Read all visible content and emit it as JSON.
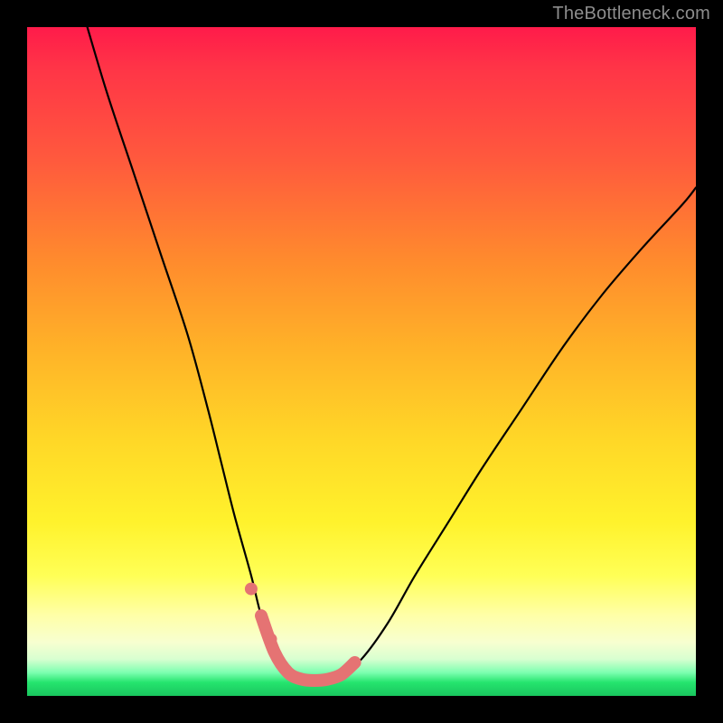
{
  "watermark": "TheBottleneck.com",
  "colors": {
    "background_frame": "#000000",
    "gradient_top": "#ff1b4a",
    "gradient_mid1": "#ff8b2d",
    "gradient_mid2": "#ffd827",
    "gradient_low": "#ffffa8",
    "gradient_bottom": "#19c65e",
    "curve": "#000000",
    "marker": "#e57373"
  },
  "chart_data": {
    "type": "line",
    "title": "",
    "xlabel": "",
    "ylabel": "",
    "xlim": [
      0,
      100
    ],
    "ylim": [
      0,
      100
    ],
    "note": "Axis values are in relative plot-percent coordinates (no tick labels are visible in the image).",
    "series": [
      {
        "name": "bottleneck-curve",
        "x": [
          9,
          12,
          16,
          20,
          24,
          27,
          29,
          31,
          33.5,
          35,
          37,
          39,
          41,
          43,
          45,
          47,
          50,
          54,
          58,
          63,
          68,
          74,
          80,
          86,
          92,
          98,
          100
        ],
        "y": [
          100,
          90,
          78,
          66,
          54,
          43,
          35,
          27,
          18,
          12,
          6.5,
          3.5,
          2.5,
          2.3,
          2.5,
          3.2,
          5.5,
          11,
          18,
          26,
          34,
          43,
          52,
          60,
          67,
          73.5,
          76
        ],
        "stroke": "#000000"
      },
      {
        "name": "bottom-highlight",
        "x": [
          35,
          37,
          39,
          41,
          43,
          45,
          47,
          49
        ],
        "y": [
          12,
          6.5,
          3.5,
          2.5,
          2.3,
          2.5,
          3.2,
          5.0
        ],
        "stroke": "#e57373",
        "marker_dots_x": [
          33.5,
          35,
          36.5
        ],
        "marker_dots_y": [
          16,
          12,
          8.5
        ]
      }
    ]
  }
}
